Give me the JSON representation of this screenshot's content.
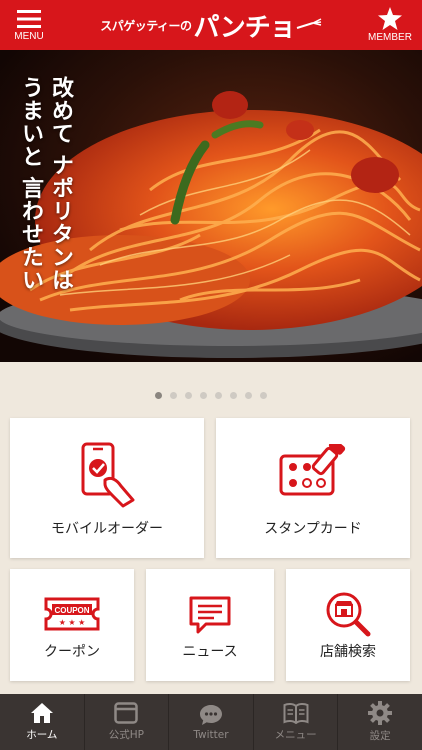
{
  "header": {
    "menu_label": "MENU",
    "member_label": "MEMBER",
    "logo_small": "スパゲッティーの",
    "logo_big": "パンチョ"
  },
  "hero": {
    "line1": "改めて",
    "line2": "ナポリタンは",
    "line3": "うまいと",
    "line4": "言わせたい"
  },
  "carousel": {
    "count": 8,
    "active": 0
  },
  "tiles": {
    "mobile_order": "モバイルオーダー",
    "stamp_card": "スタンプカード",
    "coupon": "クーポン",
    "coupon_badge": "COUPON",
    "news": "ニュース",
    "store_search": "店舗検索"
  },
  "tabbar": {
    "home": "ホーム",
    "official_hp": "公式HP",
    "twitter": "Twitter",
    "menu": "メニュー",
    "settings": "設定"
  },
  "colors": {
    "brand_red": "#d7161b",
    "tabbar_bg": "#3a3432"
  }
}
